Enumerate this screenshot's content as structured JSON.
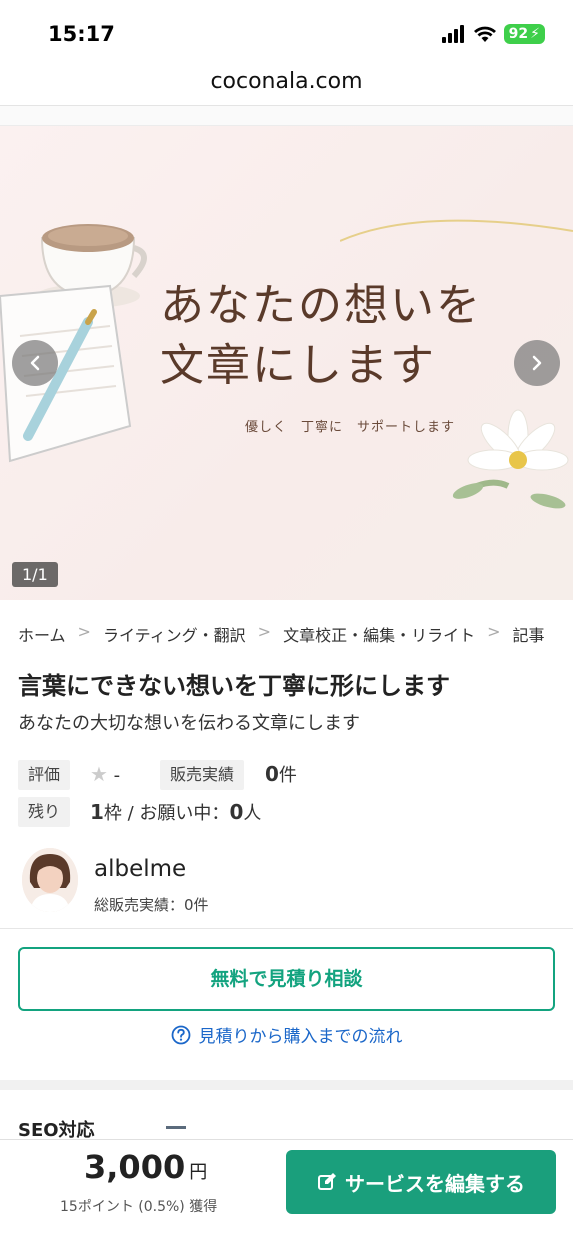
{
  "status": {
    "time": "15:17",
    "battery": "92"
  },
  "browser": {
    "url": "coconala.com"
  },
  "hero": {
    "title_line1": "あなたの想いを",
    "title_line2": "文章にします",
    "subtitle": "優しく　丁寧に　サポートします",
    "counter": "1/1"
  },
  "breadcrumb": [
    "ホーム",
    "ライティング・翻訳",
    "文章校正・編集・リライト",
    "記事"
  ],
  "service": {
    "title": "言葉にできない想いを丁寧に形にします",
    "subtitle": "あなたの大切な想いを伝わる文章にします"
  },
  "stats": {
    "rating_label": "評価",
    "rating_value": "-",
    "sales_label": "販売実績",
    "sales_value": "0",
    "sales_unit": "件",
    "remaining_label": "残り",
    "remaining_value": "1",
    "remaining_unit": "枠 / お願い中：",
    "requesting_value": "0",
    "requesting_unit": "人"
  },
  "seller": {
    "name": "albelme",
    "total_sales": "総販売実績：0件"
  },
  "actions": {
    "consult_label": "無料で見積り相談",
    "flow_link": "見積りから購入までの流れ"
  },
  "seo": {
    "label": "SEO対応"
  },
  "bottom": {
    "price": "3,000",
    "price_unit": "円",
    "points": "15ポイント (0.5%) 獲得",
    "edit_label": "サービスを編集する"
  },
  "colors": {
    "accent": "#1a9f7c",
    "link": "#1b67c9",
    "battery": "#3ecf4a"
  }
}
